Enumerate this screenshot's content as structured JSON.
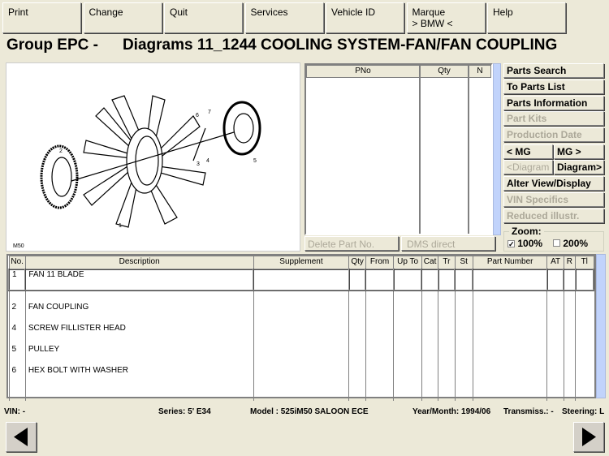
{
  "menu": [
    "Print",
    "Change",
    "Quit",
    "Services",
    "Vehicle ID",
    "Marque\n> BMW <",
    "Help"
  ],
  "title": {
    "group": "Group EPC -",
    "diagram": "Diagrams 11_1244 COOLING SYSTEM-FAN/FAN COUPLING"
  },
  "diagram": {
    "callouts": [
      "1",
      "2",
      "3",
      "4",
      "5",
      "6",
      "7"
    ],
    "engine_label": "M50"
  },
  "parts_list": {
    "headers": [
      "PNo",
      "Qty",
      "N"
    ]
  },
  "side_buttons": [
    {
      "label": "Parts Search",
      "enabled": true
    },
    {
      "label": "To Parts List",
      "enabled": true
    },
    {
      "label": "Parts Information",
      "enabled": true
    },
    {
      "label": "Part Kits",
      "enabled": false
    },
    {
      "label": "Production Date",
      "enabled": false
    }
  ],
  "mg_prev": "< MG",
  "mg_next": "MG >",
  "diagram_prev": "<Diagram",
  "diagram_next": "Diagram>",
  "side_buttons2": [
    {
      "label": "Alter View/Display",
      "enabled": true
    },
    {
      "label": "VIN Specifics",
      "enabled": false
    },
    {
      "label": "Reduced illustr.",
      "enabled": false
    }
  ],
  "delete_part": "Delete Part No.",
  "dms_direct": "DMS direct",
  "zoom": {
    "label": "Zoom:",
    "opt100": "100%",
    "opt200": "200%",
    "selected": "100%"
  },
  "table": {
    "headers": [
      "No.",
      "Description",
      "Supplement",
      "Qty",
      "From",
      "Up To",
      "Cat",
      "Tr",
      "St",
      "Part Number",
      "AT",
      "R",
      "Tl"
    ],
    "rows": [
      [
        "1",
        "FAN 11 BLADE"
      ],
      [
        "2",
        "FAN COUPLING"
      ],
      [
        "4",
        "SCREW FILLISTER HEAD"
      ],
      [
        "5",
        "PULLEY"
      ],
      [
        "6",
        "HEX BOLT WITH WASHER"
      ]
    ]
  },
  "status": {
    "vin": "VIN: -",
    "series": "Series: 5' E34",
    "model": "Model : 525iM50 SALOON ECE",
    "year": "Year/Month: 1994/06",
    "transmission": "Transmiss.: -",
    "steering": "Steering: L"
  }
}
